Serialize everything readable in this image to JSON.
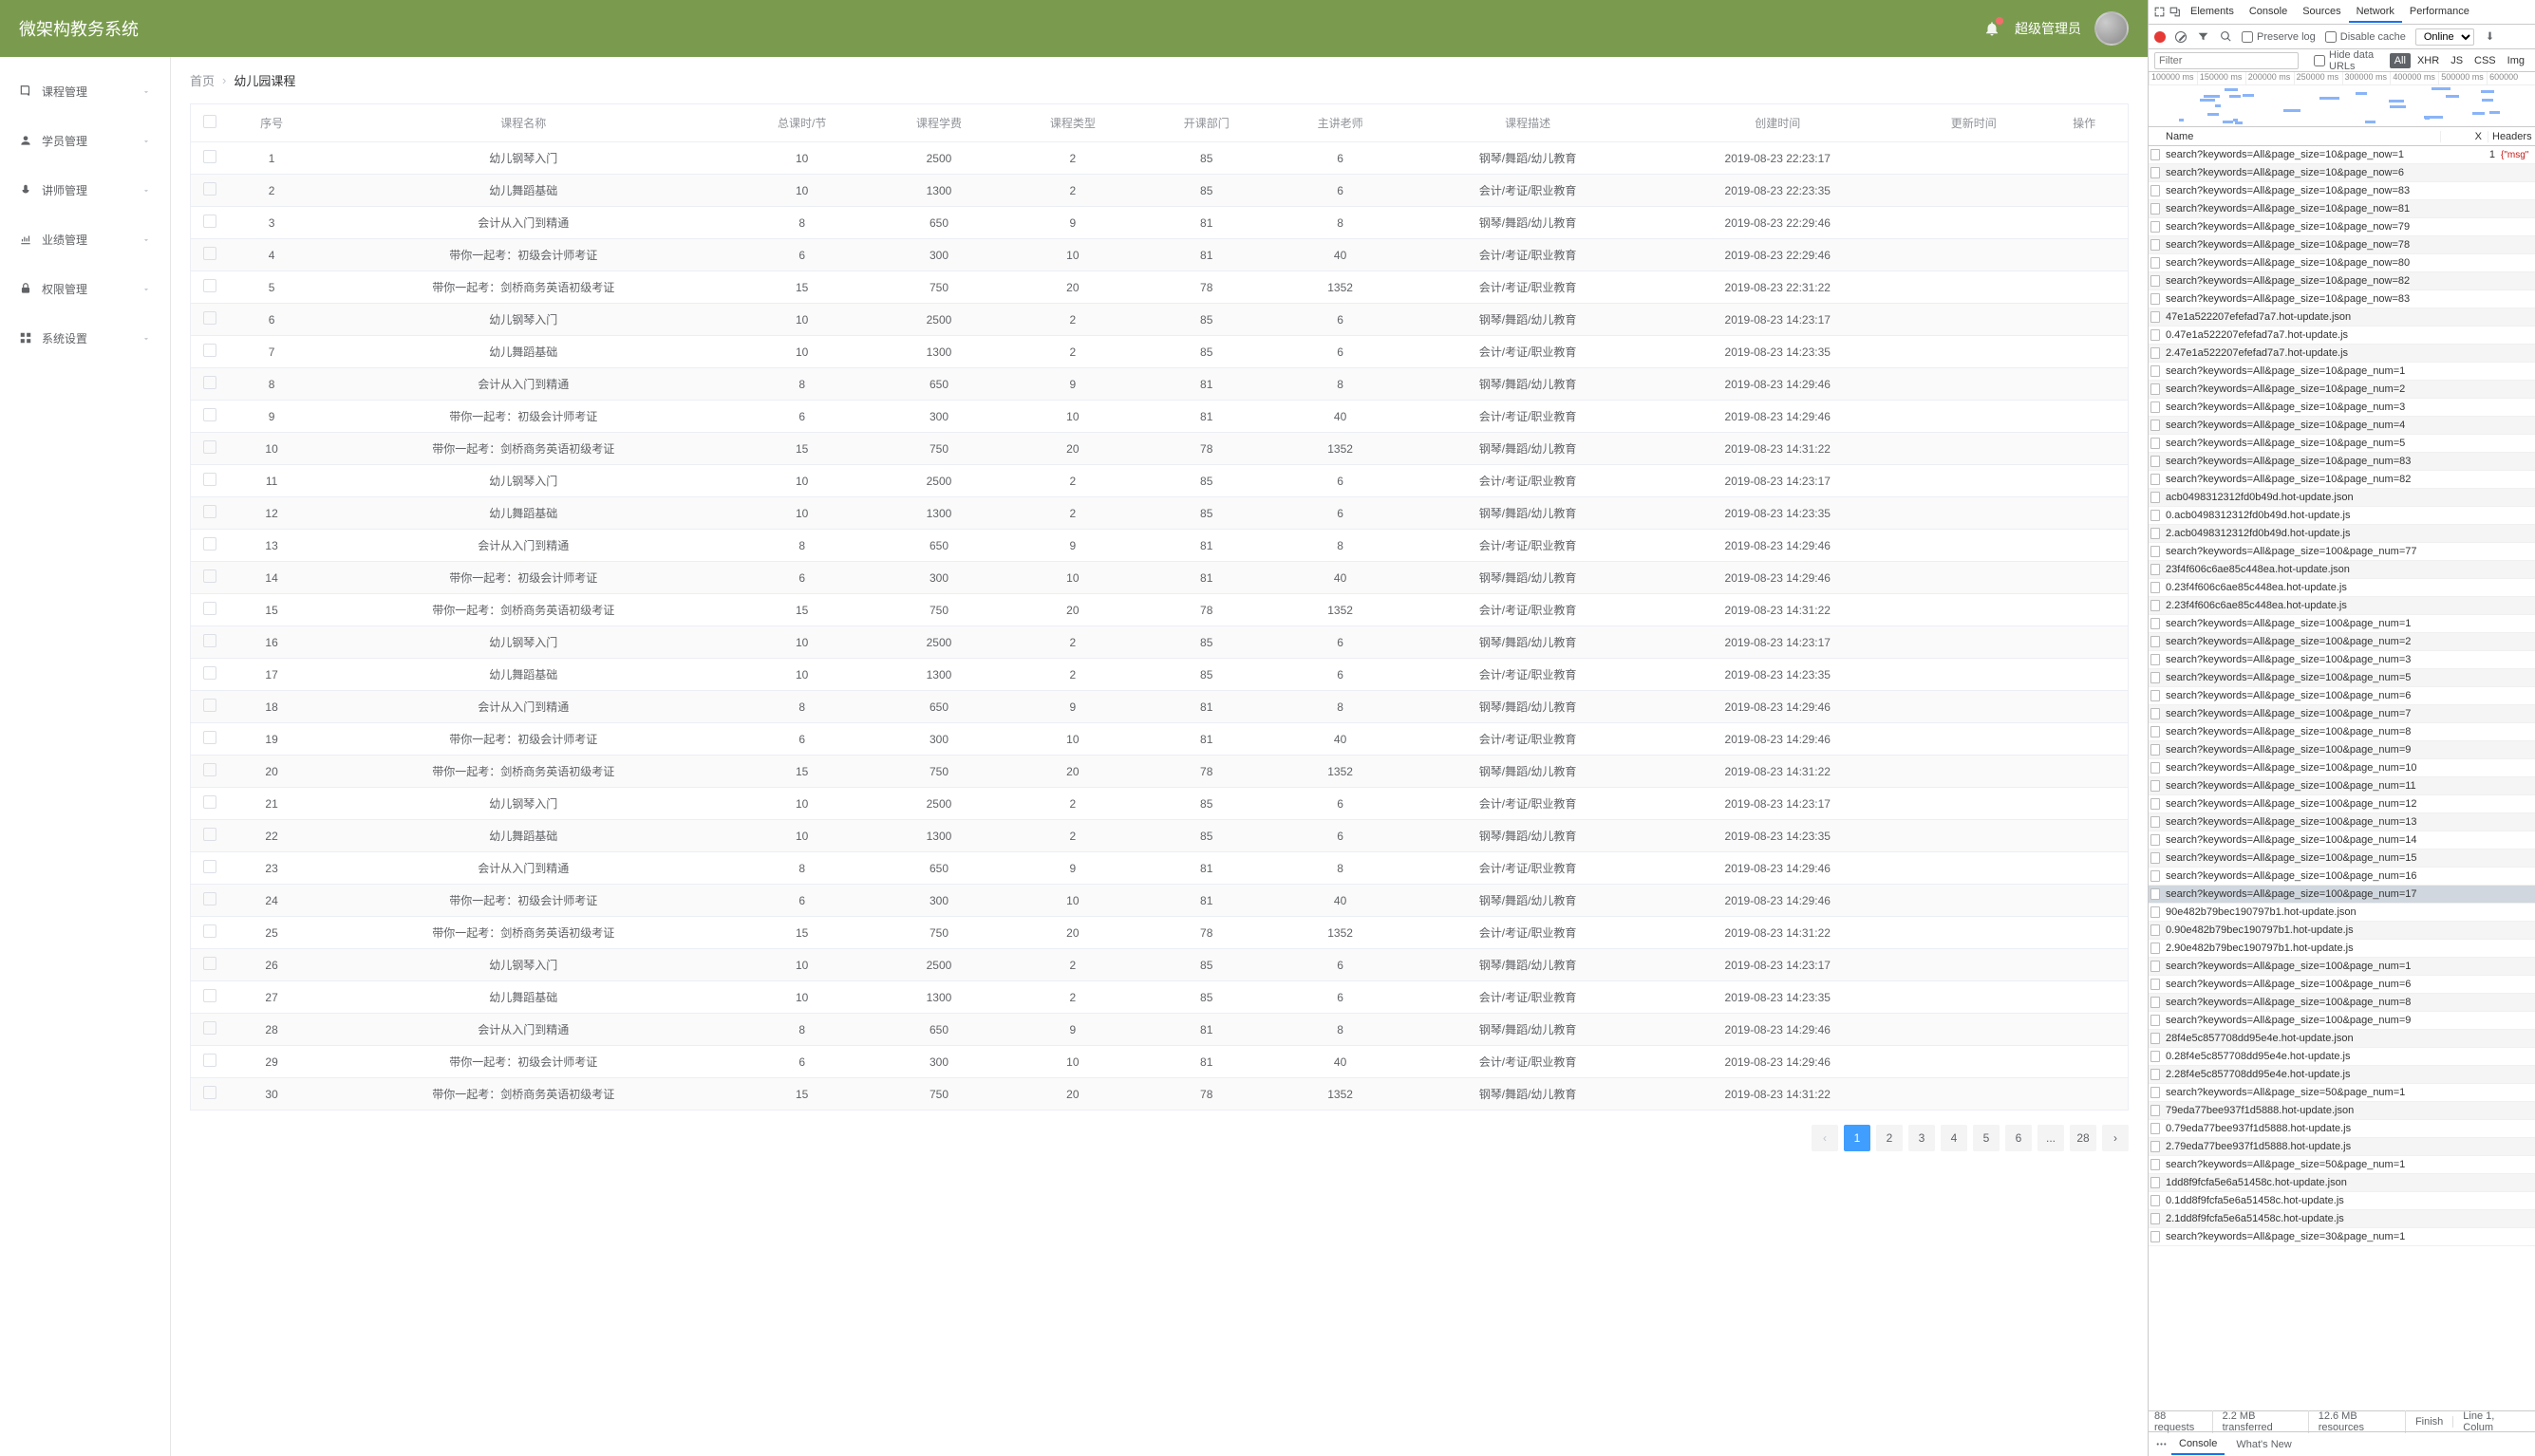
{
  "header": {
    "title": "微架构教务系统",
    "username": "超级管理员"
  },
  "sidebar": {
    "items": [
      {
        "label": "课程管理",
        "icon": "book"
      },
      {
        "label": "学员管理",
        "icon": "user"
      },
      {
        "label": "讲师管理",
        "icon": "mic"
      },
      {
        "label": "业绩管理",
        "icon": "chart"
      },
      {
        "label": "权限管理",
        "icon": "lock"
      },
      {
        "label": "系统设置",
        "icon": "grid"
      }
    ]
  },
  "breadcrumb": {
    "home": "首页",
    "current": "幼儿园课程"
  },
  "table": {
    "headers": [
      "序号",
      "课程名称",
      "总课时/节",
      "课程学费",
      "课程类型",
      "开课部门",
      "主讲老师",
      "课程描述",
      "创建时间",
      "更新时间",
      "操作"
    ],
    "rows": [
      {
        "idx": "1",
        "name": "幼儿钢琴入门",
        "hours": "10",
        "fee": "2500",
        "type": "2",
        "dept": "85",
        "teacher": "6",
        "desc": "钢琴/舞蹈/幼儿教育",
        "created": "2019-08-23 22:23:17",
        "updated": ""
      },
      {
        "idx": "2",
        "name": "幼儿舞蹈基础",
        "hours": "10",
        "fee": "1300",
        "type": "2",
        "dept": "85",
        "teacher": "6",
        "desc": "会计/考证/职业教育",
        "created": "2019-08-23 22:23:35",
        "updated": ""
      },
      {
        "idx": "3",
        "name": "会计从入门到精通",
        "hours": "8",
        "fee": "650",
        "type": "9",
        "dept": "81",
        "teacher": "8",
        "desc": "钢琴/舞蹈/幼儿教育",
        "created": "2019-08-23 22:29:46",
        "updated": ""
      },
      {
        "idx": "4",
        "name": "带你一起考：初级会计师考证",
        "hours": "6",
        "fee": "300",
        "type": "10",
        "dept": "81",
        "teacher": "40",
        "desc": "会计/考证/职业教育",
        "created": "2019-08-23 22:29:46",
        "updated": ""
      },
      {
        "idx": "5",
        "name": "带你一起考：剑桥商务英语初级考证",
        "hours": "15",
        "fee": "750",
        "type": "20",
        "dept": "78",
        "teacher": "1352",
        "desc": "会计/考证/职业教育",
        "created": "2019-08-23 22:31:22",
        "updated": ""
      },
      {
        "idx": "6",
        "name": "幼儿钢琴入门",
        "hours": "10",
        "fee": "2500",
        "type": "2",
        "dept": "85",
        "teacher": "6",
        "desc": "钢琴/舞蹈/幼儿教育",
        "created": "2019-08-23 14:23:17",
        "updated": ""
      },
      {
        "idx": "7",
        "name": "幼儿舞蹈基础",
        "hours": "10",
        "fee": "1300",
        "type": "2",
        "dept": "85",
        "teacher": "6",
        "desc": "会计/考证/职业教育",
        "created": "2019-08-23 14:23:35",
        "updated": ""
      },
      {
        "idx": "8",
        "name": "会计从入门到精通",
        "hours": "8",
        "fee": "650",
        "type": "9",
        "dept": "81",
        "teacher": "8",
        "desc": "钢琴/舞蹈/幼儿教育",
        "created": "2019-08-23 14:29:46",
        "updated": ""
      },
      {
        "idx": "9",
        "name": "带你一起考：初级会计师考证",
        "hours": "6",
        "fee": "300",
        "type": "10",
        "dept": "81",
        "teacher": "40",
        "desc": "会计/考证/职业教育",
        "created": "2019-08-23 14:29:46",
        "updated": ""
      },
      {
        "idx": "10",
        "name": "带你一起考：剑桥商务英语初级考证",
        "hours": "15",
        "fee": "750",
        "type": "20",
        "dept": "78",
        "teacher": "1352",
        "desc": "钢琴/舞蹈/幼儿教育",
        "created": "2019-08-23 14:31:22",
        "updated": ""
      },
      {
        "idx": "11",
        "name": "幼儿钢琴入门",
        "hours": "10",
        "fee": "2500",
        "type": "2",
        "dept": "85",
        "teacher": "6",
        "desc": "会计/考证/职业教育",
        "created": "2019-08-23 14:23:17",
        "updated": ""
      },
      {
        "idx": "12",
        "name": "幼儿舞蹈基础",
        "hours": "10",
        "fee": "1300",
        "type": "2",
        "dept": "85",
        "teacher": "6",
        "desc": "钢琴/舞蹈/幼儿教育",
        "created": "2019-08-23 14:23:35",
        "updated": ""
      },
      {
        "idx": "13",
        "name": "会计从入门到精通",
        "hours": "8",
        "fee": "650",
        "type": "9",
        "dept": "81",
        "teacher": "8",
        "desc": "会计/考证/职业教育",
        "created": "2019-08-23 14:29:46",
        "updated": ""
      },
      {
        "idx": "14",
        "name": "带你一起考：初级会计师考证",
        "hours": "6",
        "fee": "300",
        "type": "10",
        "dept": "81",
        "teacher": "40",
        "desc": "钢琴/舞蹈/幼儿教育",
        "created": "2019-08-23 14:29:46",
        "updated": ""
      },
      {
        "idx": "15",
        "name": "带你一起考：剑桥商务英语初级考证",
        "hours": "15",
        "fee": "750",
        "type": "20",
        "dept": "78",
        "teacher": "1352",
        "desc": "会计/考证/职业教育",
        "created": "2019-08-23 14:31:22",
        "updated": ""
      },
      {
        "idx": "16",
        "name": "幼儿钢琴入门",
        "hours": "10",
        "fee": "2500",
        "type": "2",
        "dept": "85",
        "teacher": "6",
        "desc": "钢琴/舞蹈/幼儿教育",
        "created": "2019-08-23 14:23:17",
        "updated": ""
      },
      {
        "idx": "17",
        "name": "幼儿舞蹈基础",
        "hours": "10",
        "fee": "1300",
        "type": "2",
        "dept": "85",
        "teacher": "6",
        "desc": "会计/考证/职业教育",
        "created": "2019-08-23 14:23:35",
        "updated": ""
      },
      {
        "idx": "18",
        "name": "会计从入门到精通",
        "hours": "8",
        "fee": "650",
        "type": "9",
        "dept": "81",
        "teacher": "8",
        "desc": "钢琴/舞蹈/幼儿教育",
        "created": "2019-08-23 14:29:46",
        "updated": ""
      },
      {
        "idx": "19",
        "name": "带你一起考：初级会计师考证",
        "hours": "6",
        "fee": "300",
        "type": "10",
        "dept": "81",
        "teacher": "40",
        "desc": "会计/考证/职业教育",
        "created": "2019-08-23 14:29:46",
        "updated": ""
      },
      {
        "idx": "20",
        "name": "带你一起考：剑桥商务英语初级考证",
        "hours": "15",
        "fee": "750",
        "type": "20",
        "dept": "78",
        "teacher": "1352",
        "desc": "钢琴/舞蹈/幼儿教育",
        "created": "2019-08-23 14:31:22",
        "updated": ""
      },
      {
        "idx": "21",
        "name": "幼儿钢琴入门",
        "hours": "10",
        "fee": "2500",
        "type": "2",
        "dept": "85",
        "teacher": "6",
        "desc": "会计/考证/职业教育",
        "created": "2019-08-23 14:23:17",
        "updated": ""
      },
      {
        "idx": "22",
        "name": "幼儿舞蹈基础",
        "hours": "10",
        "fee": "1300",
        "type": "2",
        "dept": "85",
        "teacher": "6",
        "desc": "钢琴/舞蹈/幼儿教育",
        "created": "2019-08-23 14:23:35",
        "updated": ""
      },
      {
        "idx": "23",
        "name": "会计从入门到精通",
        "hours": "8",
        "fee": "650",
        "type": "9",
        "dept": "81",
        "teacher": "8",
        "desc": "会计/考证/职业教育",
        "created": "2019-08-23 14:29:46",
        "updated": ""
      },
      {
        "idx": "24",
        "name": "带你一起考：初级会计师考证",
        "hours": "6",
        "fee": "300",
        "type": "10",
        "dept": "81",
        "teacher": "40",
        "desc": "钢琴/舞蹈/幼儿教育",
        "created": "2019-08-23 14:29:46",
        "updated": ""
      },
      {
        "idx": "25",
        "name": "带你一起考：剑桥商务英语初级考证",
        "hours": "15",
        "fee": "750",
        "type": "20",
        "dept": "78",
        "teacher": "1352",
        "desc": "会计/考证/职业教育",
        "created": "2019-08-23 14:31:22",
        "updated": ""
      },
      {
        "idx": "26",
        "name": "幼儿钢琴入门",
        "hours": "10",
        "fee": "2500",
        "type": "2",
        "dept": "85",
        "teacher": "6",
        "desc": "钢琴/舞蹈/幼儿教育",
        "created": "2019-08-23 14:23:17",
        "updated": ""
      },
      {
        "idx": "27",
        "name": "幼儿舞蹈基础",
        "hours": "10",
        "fee": "1300",
        "type": "2",
        "dept": "85",
        "teacher": "6",
        "desc": "会计/考证/职业教育",
        "created": "2019-08-23 14:23:35",
        "updated": ""
      },
      {
        "idx": "28",
        "name": "会计从入门到精通",
        "hours": "8",
        "fee": "650",
        "type": "9",
        "dept": "81",
        "teacher": "8",
        "desc": "钢琴/舞蹈/幼儿教育",
        "created": "2019-08-23 14:29:46",
        "updated": ""
      },
      {
        "idx": "29",
        "name": "带你一起考：初级会计师考证",
        "hours": "6",
        "fee": "300",
        "type": "10",
        "dept": "81",
        "teacher": "40",
        "desc": "会计/考证/职业教育",
        "created": "2019-08-23 14:29:46",
        "updated": ""
      },
      {
        "idx": "30",
        "name": "带你一起考：剑桥商务英语初级考证",
        "hours": "15",
        "fee": "750",
        "type": "20",
        "dept": "78",
        "teacher": "1352",
        "desc": "钢琴/舞蹈/幼儿教育",
        "created": "2019-08-23 14:31:22",
        "updated": ""
      }
    ]
  },
  "pagination": {
    "pages": [
      "1",
      "2",
      "3",
      "4",
      "5",
      "6",
      "...",
      "28"
    ],
    "active": "1"
  },
  "devtools": {
    "tabs": [
      "Elements",
      "Console",
      "Sources",
      "Network",
      "Performance"
    ],
    "active_tab": "Network",
    "toolbar": {
      "preserve_log": "Preserve log",
      "disable_cache": "Disable cache",
      "online": "Online"
    },
    "filter": {
      "placeholder": "Filter",
      "hide_data_urls": "Hide data URLs",
      "types": [
        "All",
        "XHR",
        "JS",
        "CSS",
        "Img"
      ],
      "active_type": "All"
    },
    "timeline_ticks": [
      "100000 ms",
      "150000 ms",
      "200000 ms",
      "250000 ms",
      "300000 ms",
      "400000 ms",
      "500000 ms",
      "600000"
    ],
    "cols": {
      "name": "Name",
      "x": "X",
      "headers": "Headers"
    },
    "selected_idx": 41,
    "preview_line": "1",
    "preview_text": "{\"msg\"",
    "requests": [
      "search?keywords=All&page_size=10&page_now=1",
      "search?keywords=All&page_size=10&page_now=6",
      "search?keywords=All&page_size=10&page_now=83",
      "search?keywords=All&page_size=10&page_now=81",
      "search?keywords=All&page_size=10&page_now=79",
      "search?keywords=All&page_size=10&page_now=78",
      "search?keywords=All&page_size=10&page_now=80",
      "search?keywords=All&page_size=10&page_now=82",
      "search?keywords=All&page_size=10&page_now=83",
      "47e1a522207efefad7a7.hot-update.json",
      "0.47e1a522207efefad7a7.hot-update.js",
      "2.47e1a522207efefad7a7.hot-update.js",
      "search?keywords=All&page_size=10&page_num=1",
      "search?keywords=All&page_size=10&page_num=2",
      "search?keywords=All&page_size=10&page_num=3",
      "search?keywords=All&page_size=10&page_num=4",
      "search?keywords=All&page_size=10&page_num=5",
      "search?keywords=All&page_size=10&page_num=83",
      "search?keywords=All&page_size=10&page_num=82",
      "acb0498312312fd0b49d.hot-update.json",
      "0.acb0498312312fd0b49d.hot-update.js",
      "2.acb0498312312fd0b49d.hot-update.js",
      "search?keywords=All&page_size=100&page_num=77",
      "23f4f606c6ae85c448ea.hot-update.json",
      "0.23f4f606c6ae85c448ea.hot-update.js",
      "2.23f4f606c6ae85c448ea.hot-update.js",
      "search?keywords=All&page_size=100&page_num=1",
      "search?keywords=All&page_size=100&page_num=2",
      "search?keywords=All&page_size=100&page_num=3",
      "search?keywords=All&page_size=100&page_num=5",
      "search?keywords=All&page_size=100&page_num=6",
      "search?keywords=All&page_size=100&page_num=7",
      "search?keywords=All&page_size=100&page_num=8",
      "search?keywords=All&page_size=100&page_num=9",
      "search?keywords=All&page_size=100&page_num=10",
      "search?keywords=All&page_size=100&page_num=11",
      "search?keywords=All&page_size=100&page_num=12",
      "search?keywords=All&page_size=100&page_num=13",
      "search?keywords=All&page_size=100&page_num=14",
      "search?keywords=All&page_size=100&page_num=15",
      "search?keywords=All&page_size=100&page_num=16",
      "search?keywords=All&page_size=100&page_num=17",
      "90e482b79bec190797b1.hot-update.json",
      "0.90e482b79bec190797b1.hot-update.js",
      "2.90e482b79bec190797b1.hot-update.js",
      "search?keywords=All&page_size=100&page_num=1",
      "search?keywords=All&page_size=100&page_num=6",
      "search?keywords=All&page_size=100&page_num=8",
      "search?keywords=All&page_size=100&page_num=9",
      "28f4e5c857708dd95e4e.hot-update.json",
      "0.28f4e5c857708dd95e4e.hot-update.js",
      "2.28f4e5c857708dd95e4e.hot-update.js",
      "search?keywords=All&page_size=50&page_num=1",
      "79eda77bee937f1d5888.hot-update.json",
      "0.79eda77bee937f1d5888.hot-update.js",
      "2.79eda77bee937f1d5888.hot-update.js",
      "search?keywords=All&page_size=50&page_num=1",
      "1dd8f9fcfa5e6a51458c.hot-update.json",
      "0.1dd8f9fcfa5e6a51458c.hot-update.js",
      "2.1dd8f9fcfa5e6a51458c.hot-update.js",
      "search?keywords=All&page_size=30&page_num=1"
    ],
    "status": {
      "requests": "88 requests",
      "transferred": "2.2 MB transferred",
      "resources": "12.6 MB resources",
      "finish": "Finish",
      "line": "Line 1, Colum"
    },
    "drawer": {
      "console": "Console",
      "whats_new": "What's New"
    }
  }
}
